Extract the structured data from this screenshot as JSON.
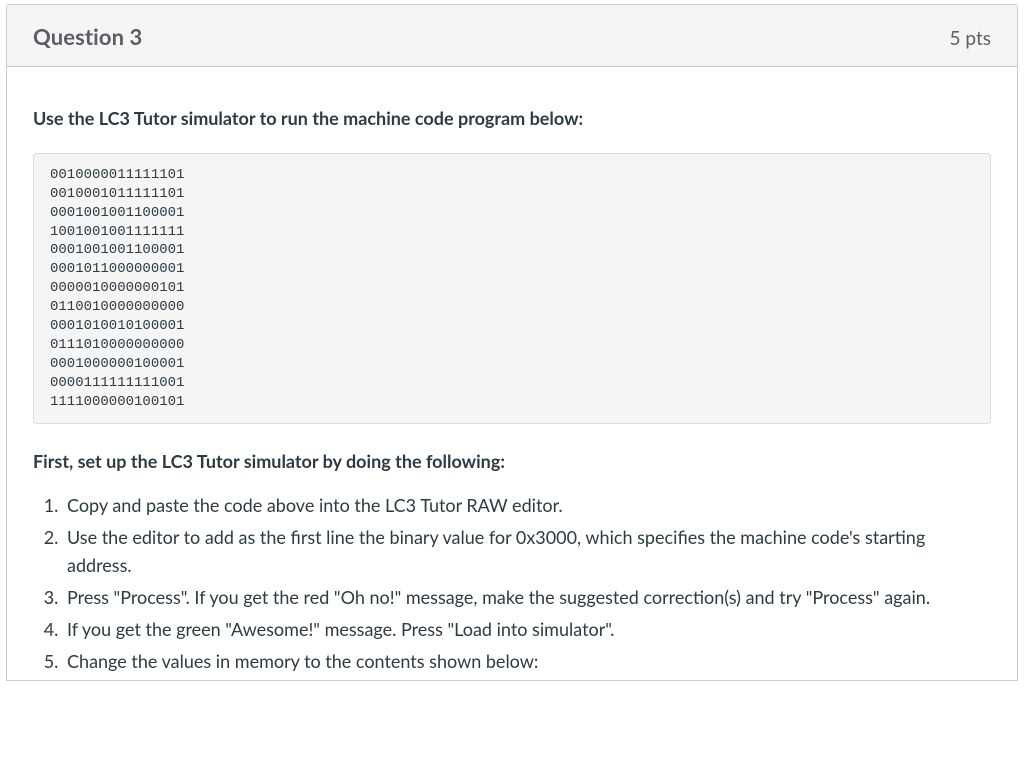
{
  "header": {
    "title": "Question 3",
    "points": "5 pts"
  },
  "body": {
    "prompt": "Use the LC3 Tutor simulator to run the machine code program below:",
    "code": "0010000011111101\n0010001011111101\n0001001001100001\n1001001001111111\n0001001001100001\n0001011000000001\n0000010000000101\n0110010000000000\n0001010010100001\n0111010000000000\n0001000000100001\n0000111111111001\n1111000000100101",
    "sub_prompt": "First, set up the LC3 Tutor simulator by doing the following:",
    "steps": [
      "Copy and paste the code above into the LC3 Tutor RAW editor.",
      "Use the editor to add as the first line the binary value for 0x3000, which specifies the machine code's starting address.",
      "Press \"Process\". If you get the red \"Oh no!\" message, make the suggested correction(s) and try \"Process\" again.",
      "If you get the green \"Awesome!\" message. Press \"Load into simulator\".",
      "Change the values in memory to the contents shown below:"
    ]
  }
}
